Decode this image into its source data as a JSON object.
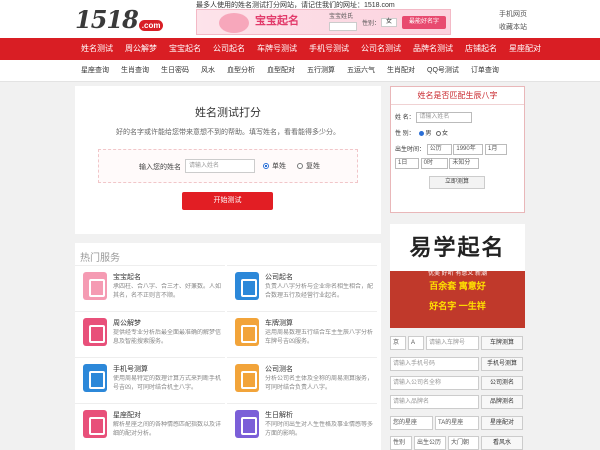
{
  "header": {
    "logo_number": "1518",
    "logo_domain": ".com",
    "tagline": "最多人使用的姓名测试打分网站，请记住我们的网址：1518.com",
    "banner": {
      "title": "宝宝起名",
      "field_label": "宝宝姓氏",
      "gender_label": "性别：",
      "gender_value": "女",
      "button": "最能好名字"
    },
    "links": [
      "手机网页",
      "收藏本站"
    ]
  },
  "nav": [
    "姓名测试",
    "周公解梦",
    "宝宝起名",
    "公司起名",
    "车牌号测试",
    "手机号测试",
    "公司名测试",
    "品牌名测试",
    "店铺起名",
    "星座配对"
  ],
  "subnav": [
    "星座查询",
    "生肖查询",
    "生日密码",
    "风水",
    "血型分析",
    "血型配对",
    "五行测算",
    "五运六气",
    "生肖配对",
    "QQ号测试",
    "订单查询"
  ],
  "main": {
    "title": "姓名测试打分",
    "description": "好的名字或许能给您带来意想不到的帮助。填写姓名，看看能得多少分。",
    "form_label": "输入您的姓名",
    "name_placeholder": "请输入姓名",
    "radio_single": "单姓",
    "radio_compound": "复姓",
    "submit": "开始测试"
  },
  "services": {
    "title": "热门服务",
    "items": [
      {
        "name": "宝宝起名",
        "desc": "承四柱、合八字、合三才、好兼数。人如其名，名不正则言不顺。",
        "color": "#f59bb3"
      },
      {
        "name": "公司起名",
        "desc": "负责人八字分析与企业命名相生相合，配合数理五行及经营行业起名。",
        "color": "#2c88d9"
      },
      {
        "name": "周公解梦",
        "desc": "提供经专业分析后最全面最准确的解梦信息及智能搜索服务。",
        "color": "#e8507a"
      },
      {
        "name": "车牌测算",
        "desc": "运用周易数理五行结合车主生辰八字分析车牌号吉凶服务。",
        "color": "#f2a43a"
      },
      {
        "name": "手机号测算",
        "desc": "使用周易特定的数理计算方式来判断手机号吉凶，可同时结合机主八字。",
        "color": "#2c88d9"
      },
      {
        "name": "公司测名",
        "desc": "分析公司名主体及全称的周易测算服务，可同时结合负责人八字。",
        "color": "#f2a43a"
      },
      {
        "name": "星座配对",
        "desc": "解析星座之间的各种情感匹配指数以及详细的配对分析。",
        "color": "#e8507a"
      },
      {
        "name": "生日解析",
        "desc": "不同时间出生对人生性格及事业情感等多方面的影响。",
        "color": "#7b5fd8"
      }
    ]
  },
  "side_form": {
    "title": "姓名是否匹配生辰八字",
    "name_label": "姓 名：",
    "name_placeholder": "请输入姓名",
    "gender_label": "性 别：",
    "male": "男",
    "female": "女",
    "birth_label": "出生时间：",
    "calendar": "公历",
    "year": "1990年",
    "month": "1月",
    "day": "1日",
    "hour": "0时",
    "minute": "未知分",
    "submit": "立即测算"
  },
  "ad": {
    "headline": "易学起名",
    "tags": "优美  好听  有意义  新潮",
    "line1": "百余套  寓意好",
    "line2": "好名字  一生祥"
  },
  "tools": {
    "plate": {
      "province": "京",
      "letter": "A",
      "placeholder": "请输入车牌号",
      "button": "车牌测算"
    },
    "phone": {
      "placeholder": "请输入手机号码",
      "button": "手机号测算"
    },
    "company": {
      "placeholder": "请输入公司名全称",
      "button": "公司测名"
    },
    "brand": {
      "placeholder": "请输入品牌名",
      "button": "品牌测名"
    },
    "zodiac": {
      "mine": "您的星座",
      "theirs": "TA的星座",
      "button": "星座配对"
    },
    "fengshui": {
      "gender": "性别",
      "year": "出生公历",
      "door": "大门朝",
      "button": "看风水"
    }
  }
}
